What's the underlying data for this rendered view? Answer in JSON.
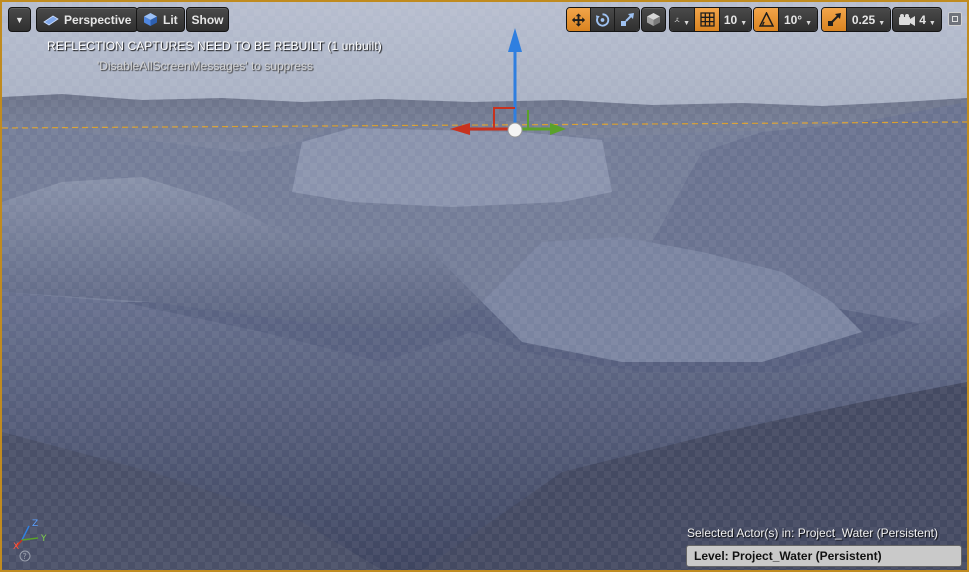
{
  "toolbar": {
    "menu_icon": "chevron-down-icon",
    "perspective_label": "Perspective",
    "lit_label": "Lit",
    "show_label": "Show",
    "grid_snap_value": "10",
    "rotation_snap_value": "10°",
    "scale_snap_value": "0.25",
    "camera_speed_value": "4"
  },
  "messages": {
    "reflection_warning": "REFLECTION CAPTURES NEED TO BE REBUILT (1 unbuilt)",
    "suppress_hint": "'DisableAllScreenMessages' to suppress"
  },
  "status": {
    "selected_actor_label": "Selected Actor(s) in:  Project_Water (Persistent)",
    "level_label": "Level:  Project_Water (Persistent)"
  },
  "colors": {
    "active_accent": "#e8922f",
    "viewport_border": "#c08b1f",
    "gizmo_x": "#c8321e",
    "gizmo_y": "#5aa12a",
    "gizmo_z": "#2f7fe0"
  },
  "icons": {
    "translate": "translate-icon",
    "rotate": "rotate-icon",
    "scale": "scale-icon",
    "world_local": "world-cube-icon",
    "surface_snap": "surface-snap-icon",
    "grid": "grid-icon",
    "rotation": "angle-icon",
    "scale_snap": "scale-snap-icon",
    "camera": "camera-speed-icon",
    "maximize": "maximize-icon"
  }
}
